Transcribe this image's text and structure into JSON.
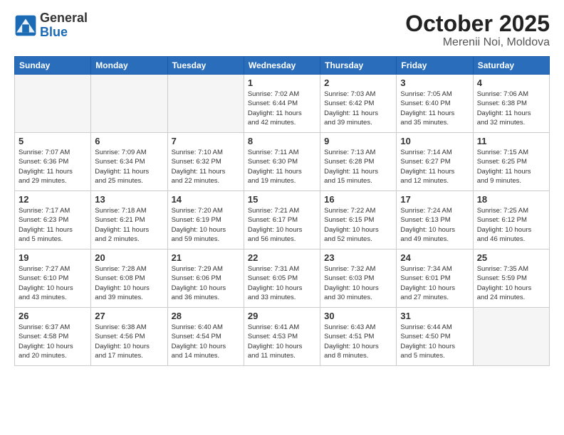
{
  "header": {
    "logo_general": "General",
    "logo_blue": "Blue",
    "month_year": "October 2025",
    "location": "Merenii Noi, Moldova"
  },
  "weekdays": [
    "Sunday",
    "Monday",
    "Tuesday",
    "Wednesday",
    "Thursday",
    "Friday",
    "Saturday"
  ],
  "weeks": [
    [
      {
        "day": "",
        "info": ""
      },
      {
        "day": "",
        "info": ""
      },
      {
        "day": "",
        "info": ""
      },
      {
        "day": "1",
        "info": "Sunrise: 7:02 AM\nSunset: 6:44 PM\nDaylight: 11 hours\nand 42 minutes."
      },
      {
        "day": "2",
        "info": "Sunrise: 7:03 AM\nSunset: 6:42 PM\nDaylight: 11 hours\nand 39 minutes."
      },
      {
        "day": "3",
        "info": "Sunrise: 7:05 AM\nSunset: 6:40 PM\nDaylight: 11 hours\nand 35 minutes."
      },
      {
        "day": "4",
        "info": "Sunrise: 7:06 AM\nSunset: 6:38 PM\nDaylight: 11 hours\nand 32 minutes."
      }
    ],
    [
      {
        "day": "5",
        "info": "Sunrise: 7:07 AM\nSunset: 6:36 PM\nDaylight: 11 hours\nand 29 minutes."
      },
      {
        "day": "6",
        "info": "Sunrise: 7:09 AM\nSunset: 6:34 PM\nDaylight: 11 hours\nand 25 minutes."
      },
      {
        "day": "7",
        "info": "Sunrise: 7:10 AM\nSunset: 6:32 PM\nDaylight: 11 hours\nand 22 minutes."
      },
      {
        "day": "8",
        "info": "Sunrise: 7:11 AM\nSunset: 6:30 PM\nDaylight: 11 hours\nand 19 minutes."
      },
      {
        "day": "9",
        "info": "Sunrise: 7:13 AM\nSunset: 6:28 PM\nDaylight: 11 hours\nand 15 minutes."
      },
      {
        "day": "10",
        "info": "Sunrise: 7:14 AM\nSunset: 6:27 PM\nDaylight: 11 hours\nand 12 minutes."
      },
      {
        "day": "11",
        "info": "Sunrise: 7:15 AM\nSunset: 6:25 PM\nDaylight: 11 hours\nand 9 minutes."
      }
    ],
    [
      {
        "day": "12",
        "info": "Sunrise: 7:17 AM\nSunset: 6:23 PM\nDaylight: 11 hours\nand 5 minutes."
      },
      {
        "day": "13",
        "info": "Sunrise: 7:18 AM\nSunset: 6:21 PM\nDaylight: 11 hours\nand 2 minutes."
      },
      {
        "day": "14",
        "info": "Sunrise: 7:20 AM\nSunset: 6:19 PM\nDaylight: 10 hours\nand 59 minutes."
      },
      {
        "day": "15",
        "info": "Sunrise: 7:21 AM\nSunset: 6:17 PM\nDaylight: 10 hours\nand 56 minutes."
      },
      {
        "day": "16",
        "info": "Sunrise: 7:22 AM\nSunset: 6:15 PM\nDaylight: 10 hours\nand 52 minutes."
      },
      {
        "day": "17",
        "info": "Sunrise: 7:24 AM\nSunset: 6:13 PM\nDaylight: 10 hours\nand 49 minutes."
      },
      {
        "day": "18",
        "info": "Sunrise: 7:25 AM\nSunset: 6:12 PM\nDaylight: 10 hours\nand 46 minutes."
      }
    ],
    [
      {
        "day": "19",
        "info": "Sunrise: 7:27 AM\nSunset: 6:10 PM\nDaylight: 10 hours\nand 43 minutes."
      },
      {
        "day": "20",
        "info": "Sunrise: 7:28 AM\nSunset: 6:08 PM\nDaylight: 10 hours\nand 39 minutes."
      },
      {
        "day": "21",
        "info": "Sunrise: 7:29 AM\nSunset: 6:06 PM\nDaylight: 10 hours\nand 36 minutes."
      },
      {
        "day": "22",
        "info": "Sunrise: 7:31 AM\nSunset: 6:05 PM\nDaylight: 10 hours\nand 33 minutes."
      },
      {
        "day": "23",
        "info": "Sunrise: 7:32 AM\nSunset: 6:03 PM\nDaylight: 10 hours\nand 30 minutes."
      },
      {
        "day": "24",
        "info": "Sunrise: 7:34 AM\nSunset: 6:01 PM\nDaylight: 10 hours\nand 27 minutes."
      },
      {
        "day": "25",
        "info": "Sunrise: 7:35 AM\nSunset: 5:59 PM\nDaylight: 10 hours\nand 24 minutes."
      }
    ],
    [
      {
        "day": "26",
        "info": "Sunrise: 6:37 AM\nSunset: 4:58 PM\nDaylight: 10 hours\nand 20 minutes."
      },
      {
        "day": "27",
        "info": "Sunrise: 6:38 AM\nSunset: 4:56 PM\nDaylight: 10 hours\nand 17 minutes."
      },
      {
        "day": "28",
        "info": "Sunrise: 6:40 AM\nSunset: 4:54 PM\nDaylight: 10 hours\nand 14 minutes."
      },
      {
        "day": "29",
        "info": "Sunrise: 6:41 AM\nSunset: 4:53 PM\nDaylight: 10 hours\nand 11 minutes."
      },
      {
        "day": "30",
        "info": "Sunrise: 6:43 AM\nSunset: 4:51 PM\nDaylight: 10 hours\nand 8 minutes."
      },
      {
        "day": "31",
        "info": "Sunrise: 6:44 AM\nSunset: 4:50 PM\nDaylight: 10 hours\nand 5 minutes."
      },
      {
        "day": "",
        "info": ""
      }
    ]
  ]
}
